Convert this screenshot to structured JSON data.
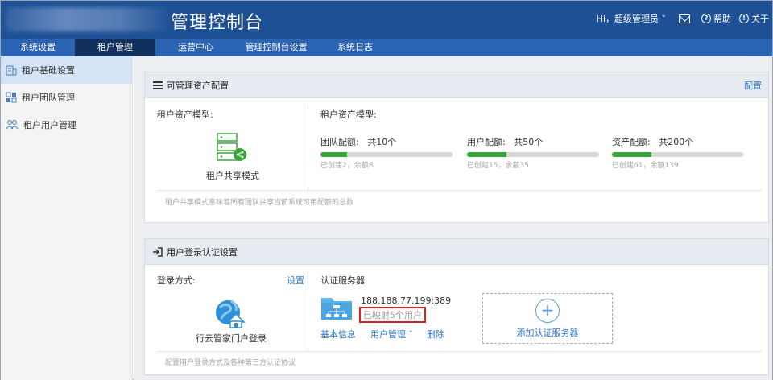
{
  "header": {
    "title": "管理控制台",
    "greeting": "Hi，超级管理员",
    "help_label": "帮助",
    "about_label": "关于"
  },
  "nav": {
    "tabs": [
      {
        "label": "系统设置"
      },
      {
        "label": "租户管理",
        "active": true
      },
      {
        "label": "运营中心"
      },
      {
        "label": "管理控制台设置"
      },
      {
        "label": "系统日志"
      }
    ]
  },
  "sidebar": {
    "items": [
      {
        "label": "租户基础设置",
        "active": true,
        "icon": "tenant-settings-icon"
      },
      {
        "label": "租户团队管理",
        "icon": "team-grid-icon"
      },
      {
        "label": "租户用户管理",
        "icon": "users-icon"
      }
    ]
  },
  "asset_panel": {
    "title": "可管理资产配置",
    "config_link": "配置",
    "left_label": "租户资产模型:",
    "mode_label": "租户共享模式",
    "right_label": "租户资产模型:",
    "quotas": [
      {
        "name": "团队配额:",
        "total": "共10个",
        "fill_fraction": 0.2,
        "sub": "已创建2，余额8"
      },
      {
        "name": "用户配额:",
        "total": "共50个",
        "fill_fraction": 0.3,
        "sub": "已创建15，余额35"
      },
      {
        "name": "资产配额:",
        "total": "共200个",
        "fill_fraction": 0.3,
        "sub": "已创建61，余额139"
      }
    ],
    "footnote": "租户共享模式意味着所有团队共享当前系统可用配额的总数"
  },
  "login_panel": {
    "title": "用户登录认证设置",
    "login_method_label": "登录方式:",
    "settings_link": "设置",
    "portal_label": "行云管家门户登录",
    "auth_server_label": "认证服务器",
    "server": {
      "address": "188.188.77.199:389",
      "mapped": "已映射5个用户",
      "basic_info": "基本信息",
      "user_mgmt": "用户管理",
      "delete": "删除"
    },
    "add_server_label": "添加认证服务器",
    "footnote": "配置用户登录方式及各种第三方认证协议"
  },
  "colors": {
    "header_bg": "#1e5096",
    "nav_bg": "#2b63b3",
    "nav_active": "#11305d",
    "accent": "#2f76c8",
    "quota_green": "#36a836",
    "highlight_red": "#e02020"
  }
}
